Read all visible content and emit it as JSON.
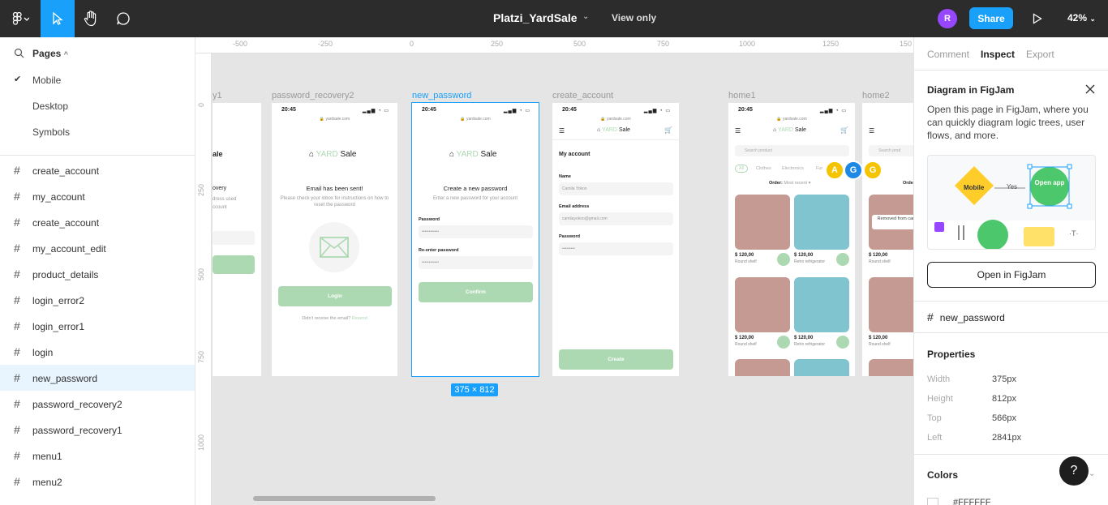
{
  "toolbar": {
    "title": "Platzi_YardSale",
    "view_mode": "View only",
    "user_initial": "R",
    "share_label": "Share",
    "zoom": "42%"
  },
  "pages": {
    "header": "Pages",
    "items": [
      {
        "label": "Mobile",
        "current": true
      },
      {
        "label": "Desktop",
        "current": false
      },
      {
        "label": "Symbols",
        "current": false
      }
    ]
  },
  "layers": [
    {
      "label": "create_account"
    },
    {
      "label": "my_account"
    },
    {
      "label": "create_account"
    },
    {
      "label": "my_account_edit"
    },
    {
      "label": "product_details"
    },
    {
      "label": "login_error2"
    },
    {
      "label": "login_error1"
    },
    {
      "label": "login"
    },
    {
      "label": "new_password",
      "selected": true
    },
    {
      "label": "password_recovery2"
    },
    {
      "label": "password_recovery1"
    },
    {
      "label": "menu1"
    },
    {
      "label": "menu2"
    }
  ],
  "ruler": {
    "top": [
      "-500",
      "-250",
      "0",
      "250",
      "500",
      "750",
      "1000",
      "1250",
      "150"
    ],
    "left": [
      "0",
      "250",
      "500",
      "750",
      "1000"
    ]
  },
  "canvas": {
    "frames": {
      "partial": {
        "label": "y1",
        "title": "ale",
        "heading": "overy",
        "sub1": "dress used",
        "sub2": "ccount"
      },
      "password_recovery2": {
        "label": "password_recovery2",
        "time": "20:45",
        "url": "yardsale.com",
        "logo_a": "YARD",
        "logo_b": " Sale",
        "heading": "Email has been sent!",
        "sub": "Please check your inbox for instructions on how to reset the password",
        "button": "Login",
        "footer_a": "Didn't receive the email?",
        "footer_b": " Resend"
      },
      "new_password": {
        "label": "new_password",
        "time": "20:45",
        "url": "yardsale.com",
        "logo_a": "YARD",
        "logo_b": " Sale",
        "heading": "Create a new password",
        "sub": "Enter a new password for your account",
        "field1_label": "Password",
        "field1_value": "••••••••••••",
        "field2_label": "Re-enter password",
        "field2_value": "••••••••••••",
        "button": "Confirm",
        "size": "375 × 812"
      },
      "create_account": {
        "label": "create_account",
        "time": "20:45",
        "url": "yardsale.com",
        "logo_a": "YARD",
        "logo_b": " Sale",
        "heading": "My account",
        "name_label": "Name",
        "name_value": "Camila Yokoo",
        "email_label": "Email address",
        "email_value": "camilayokoo@gmail.com",
        "pwd_label": "Password",
        "pwd_value": "•••••••••",
        "button": "Create"
      },
      "home1": {
        "label": "home1",
        "time": "20:45",
        "url": "yardsale.com",
        "logo_a": "YARD",
        "logo_b": " Sale",
        "search": "Search product",
        "chips": [
          "All",
          "Clothes",
          "Electronics",
          "Fur"
        ],
        "order_a": "Order:",
        "order_b": " Most recent ▾",
        "products": [
          {
            "price": "$ 120,00",
            "name": "Round shelf"
          },
          {
            "price": "$ 120,00",
            "name": "Retro refrigerator"
          },
          {
            "price": "$ 120,00",
            "name": "Round shelf"
          },
          {
            "price": "$ 120,00",
            "name": "Retro refrigerator"
          }
        ]
      },
      "home2": {
        "label": "home2",
        "search": "Search prod",
        "order": "Orde",
        "removed": "Removed from cart",
        "products": [
          {
            "price": "$ 120,00",
            "name": "Round shelf"
          },
          {
            "price": "$ 120,00",
            "name": "Round shelf"
          }
        ]
      }
    },
    "collaborators": [
      {
        "initial": "A",
        "color": "#f5c400"
      },
      {
        "initial": "G",
        "color": "#1e88e5"
      },
      {
        "initial": "G",
        "color": "#f5c400"
      }
    ]
  },
  "right_panel": {
    "tabs": [
      "Comment",
      "Inspect",
      "Export"
    ],
    "active_tab": "Inspect",
    "promo": {
      "title": "Diagram in FigJam",
      "description": "Open this page in FigJam, where you can quickly diagram logic trees, user flows, and more.",
      "diagram_node1": "Mobile",
      "diagram_edge": "Yes",
      "diagram_node2": "Open app",
      "button": "Open in FigJam"
    },
    "selected_frame": "new_password",
    "properties_title": "Properties",
    "properties": [
      {
        "key": "Width",
        "value": "375px"
      },
      {
        "key": "Height",
        "value": "812px"
      },
      {
        "key": "Top",
        "value": "566px"
      },
      {
        "key": "Left",
        "value": "2841px"
      }
    ],
    "colors_title": "Colors",
    "color_value": "#FFFFFF",
    "help": "?"
  },
  "colors": {
    "accent": "#18a0fb",
    "brand_green": "#acd9b2",
    "toolbar_bg": "#2c2c2c"
  }
}
